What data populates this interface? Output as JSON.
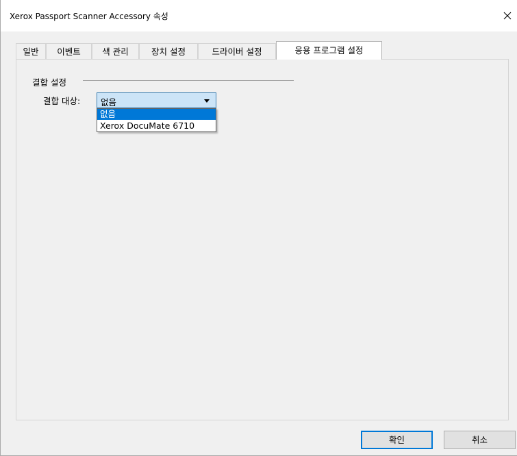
{
  "window": {
    "title": "Xerox Passport Scanner Accessory 속성",
    "close_icon": "close-icon"
  },
  "tabs": [
    {
      "label": "일반",
      "active": false
    },
    {
      "label": "이벤트",
      "active": false
    },
    {
      "label": "색 관리",
      "active": false
    },
    {
      "label": "장치 설정",
      "active": false
    },
    {
      "label": "드라이버 설정",
      "active": false
    },
    {
      "label": "응용 프로그램 설정",
      "active": true
    }
  ],
  "binding": {
    "group_label": "결합 설정",
    "target_label": "결합 대상:",
    "selected_value": "없음",
    "options": [
      {
        "label": "없음",
        "selected": true
      },
      {
        "label": "Xerox DocuMate 6710",
        "selected": false
      }
    ]
  },
  "buttons": {
    "ok": "확인",
    "cancel": "취소"
  },
  "colors": {
    "accent": "#0078d7",
    "combo_focus_bg": "#cce4f7",
    "window_bg": "#f0f0f0"
  }
}
